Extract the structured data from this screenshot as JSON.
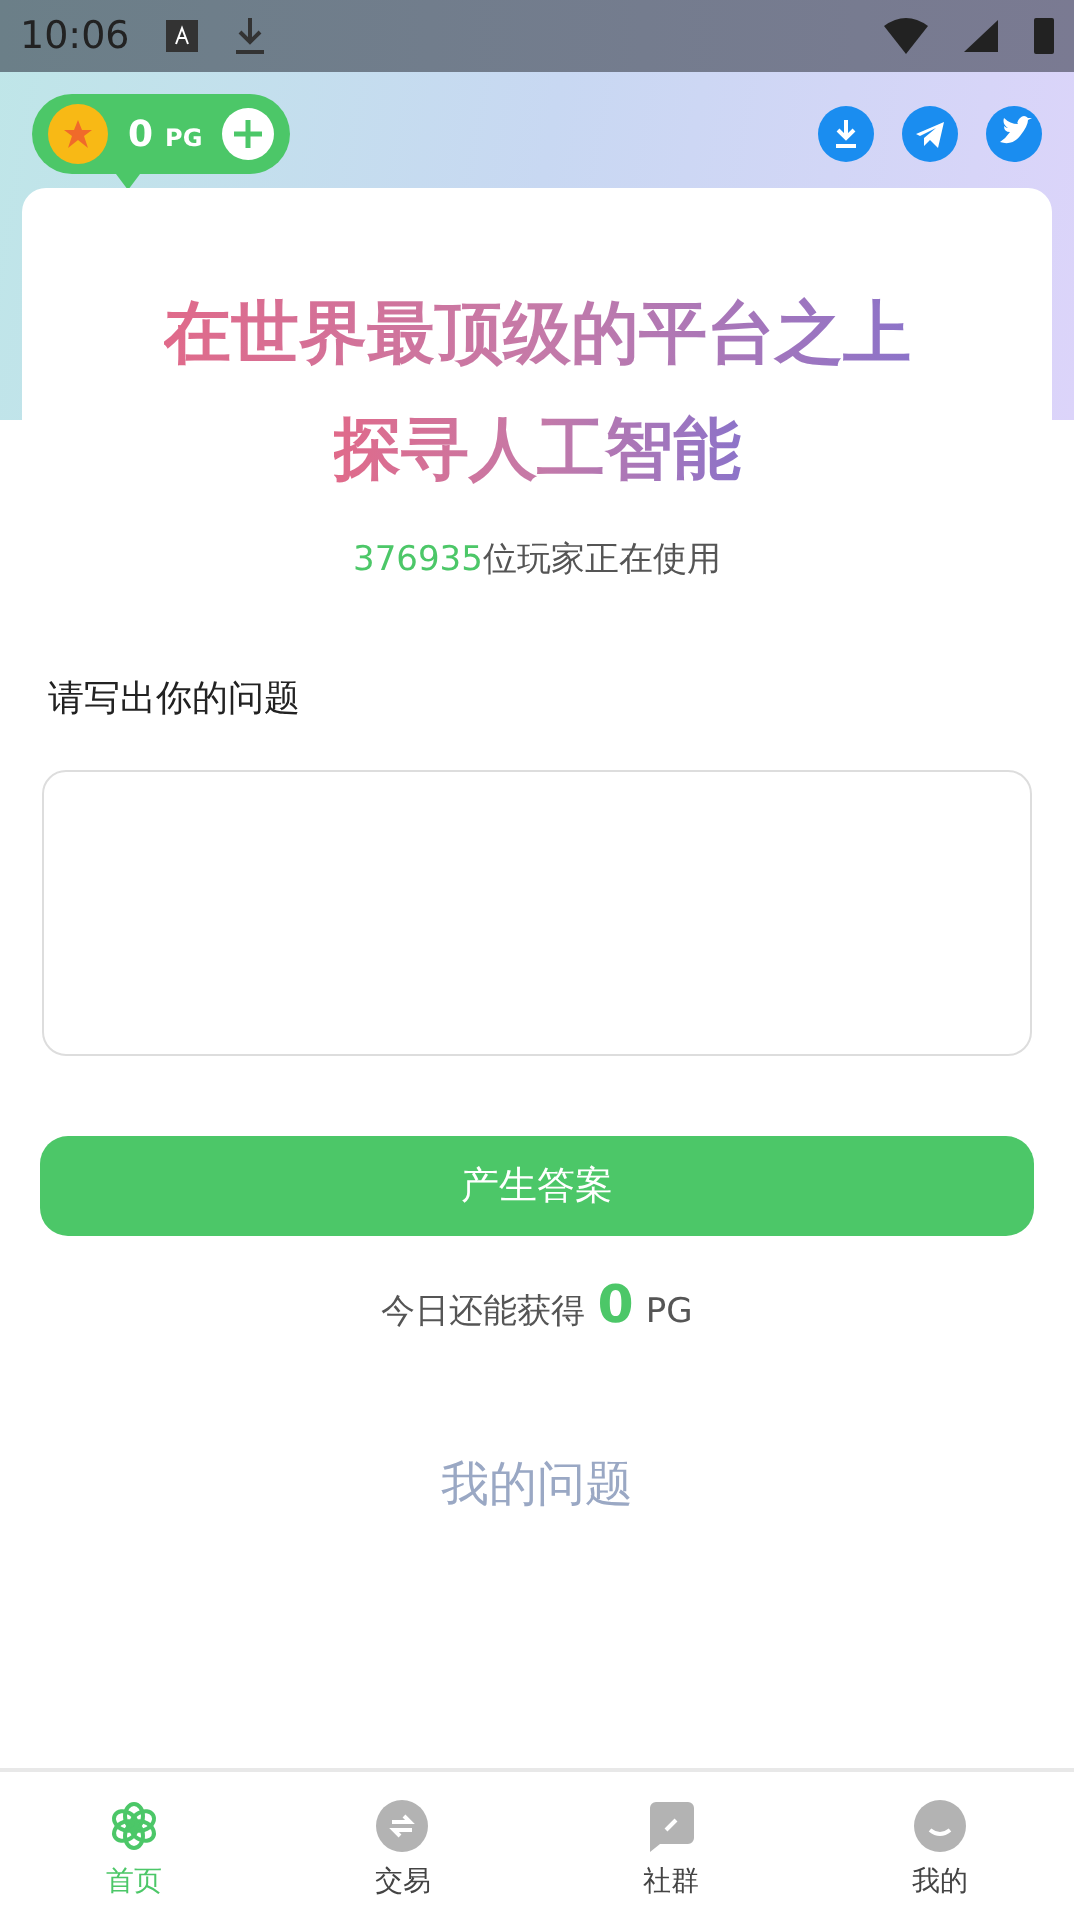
{
  "status_bar": {
    "time": "10:06"
  },
  "balance": {
    "amount": "0",
    "unit": "PG"
  },
  "hero": {
    "title_lines": [
      "在世界最顶级的平台之上",
      "探寻人工智能"
    ],
    "user_count": "376935",
    "user_suffix": "位玩家正在使用"
  },
  "question": {
    "label": "请写出你的问题"
  },
  "submit_button": "产生答案",
  "daily": {
    "prefix": "今日还能获得",
    "amount": "0",
    "unit": "PG"
  },
  "my_questions": "我的问题",
  "nav": [
    {
      "label": "首页",
      "kind": "home",
      "selected": true
    },
    {
      "label": "交易",
      "kind": "trade",
      "selected": false
    },
    {
      "label": "社群",
      "kind": "community",
      "selected": false
    },
    {
      "label": "我的",
      "kind": "profile",
      "selected": false
    }
  ]
}
